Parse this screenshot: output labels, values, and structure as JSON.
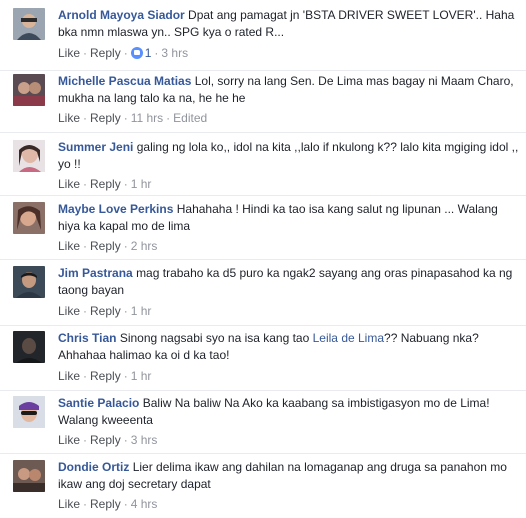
{
  "actions": {
    "like": "Like",
    "reply": "Reply",
    "edited": "Edited"
  },
  "comments": [
    {
      "author": "Arnold Mayoya Siador",
      "text": "Dpat ang pamagat jn 'BSTA DRIVER SWEET LOVER'.. Haha bka nmn mlaswa yn.. SPG kya o rated R...",
      "likes": "1",
      "time": "3 hrs"
    },
    {
      "author": "Michelle Pascua Matias",
      "text": "Lol, sorry na lang Sen. De Lima mas bagay ni Maam Charo, mukha na lang talo ka na, he he he",
      "time": "11 hrs"
    },
    {
      "author": "Summer Jeni",
      "text": "galing ng lola ko,, idol na kita ,,lalo if nkulong k?? lalo kita mgiging idol ,, yo !!",
      "time": "1 hr"
    },
    {
      "author": "Maybe Love Perkins",
      "text": "Hahahaha ! Hindi ka tao isa kang salut ng lipunan ... Walang hiya ka kapal mo de lima",
      "time": "2 hrs"
    },
    {
      "author": "Jim Pastrana",
      "text": "mag trabaho ka d5 puro ka ngak2 sayang ang oras pinapasahod ka ng taong bayan",
      "time": "1 hr"
    },
    {
      "author": "Chris Tian",
      "text_before": "Sinong nagsabi syo na isa kang tao",
      "mention": "Leila de Lima",
      "text_after": "?? Nabuang nka? Ahhahaa halimao ka oi d ka tao!",
      "time": "1 hr"
    },
    {
      "author": "Santie Palacio",
      "text": "Baliw Na baliw Na Ako ka kaabang sa imbistigasyon mo de Lima! Walang kweeenta",
      "time": "3 hrs"
    },
    {
      "author": "Dondie Ortiz",
      "text": "Lier delima ikaw ang dahilan na lomaganap ang druga sa panahon mo ikaw ang doj secretary dapat",
      "time": "4 hrs"
    }
  ]
}
